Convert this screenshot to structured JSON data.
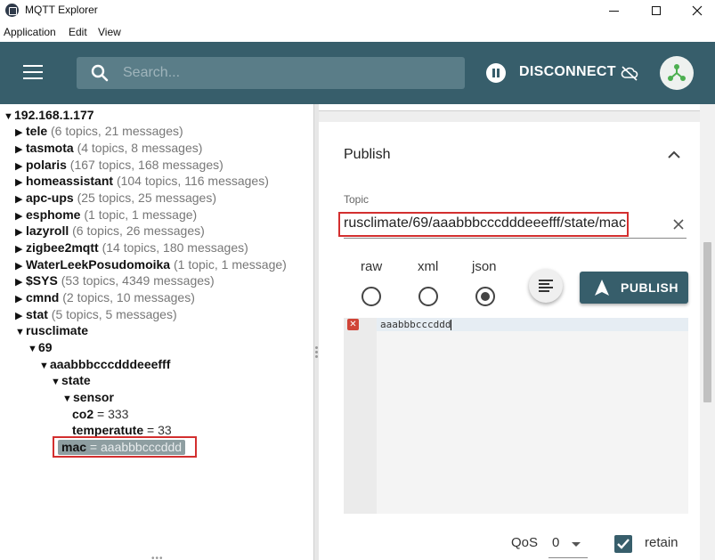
{
  "window": {
    "title": "MQTT Explorer"
  },
  "menu": [
    "Application",
    "Edit",
    "View"
  ],
  "header": {
    "search_placeholder": "Search...",
    "disconnect_label": "DISCONNECT",
    "accent": "#375e6b"
  },
  "tree": {
    "root": "192.168.1.177",
    "children": [
      {
        "name": "tele",
        "meta": "(6 topics, 21 messages)"
      },
      {
        "name": "tasmota",
        "meta": "(4 topics, 8 messages)"
      },
      {
        "name": "polaris",
        "meta": "(167 topics, 168 messages)"
      },
      {
        "name": "homeassistant",
        "meta": "(104 topics, 116 messages)"
      },
      {
        "name": "apc-ups",
        "meta": "(25 topics, 25 messages)"
      },
      {
        "name": "esphome",
        "meta": "(1 topic, 1 message)"
      },
      {
        "name": "lazyroll",
        "meta": "(6 topics, 26 messages)"
      },
      {
        "name": "zigbee2mqtt",
        "meta": "(14 topics, 180 messages)"
      },
      {
        "name": "WaterLeekPosudomoika",
        "meta": "(1 topic, 1 message)"
      },
      {
        "name": "$SYS",
        "meta": "(53 topics, 4349 messages)"
      },
      {
        "name": "cmnd",
        "meta": "(2 topics, 10 messages)"
      },
      {
        "name": "stat",
        "meta": "(5 topics, 5 messages)"
      },
      {
        "name": "rusclimate",
        "meta": ""
      }
    ],
    "nested": [
      "69",
      "aaabbbcccdddeeefff",
      "state",
      "sensor"
    ],
    "leaves": [
      {
        "key": "co2",
        "value": "333"
      },
      {
        "key": "temperatute",
        "value": "33"
      },
      {
        "key": "mac",
        "value": "aaabbbcccddd"
      }
    ]
  },
  "publish": {
    "title": "Publish",
    "topic_label": "Topic",
    "topic_value": "rusclimate/69/aaabbbcccdddeeefff/state/mac",
    "formats": [
      "raw",
      "xml",
      "json"
    ],
    "selected_format": "json",
    "button_label": "PUBLISH",
    "payload": "aaabbbcccddd",
    "qos_label": "QoS",
    "qos_value": "0",
    "retain_label": "retain",
    "retain_checked": true
  }
}
